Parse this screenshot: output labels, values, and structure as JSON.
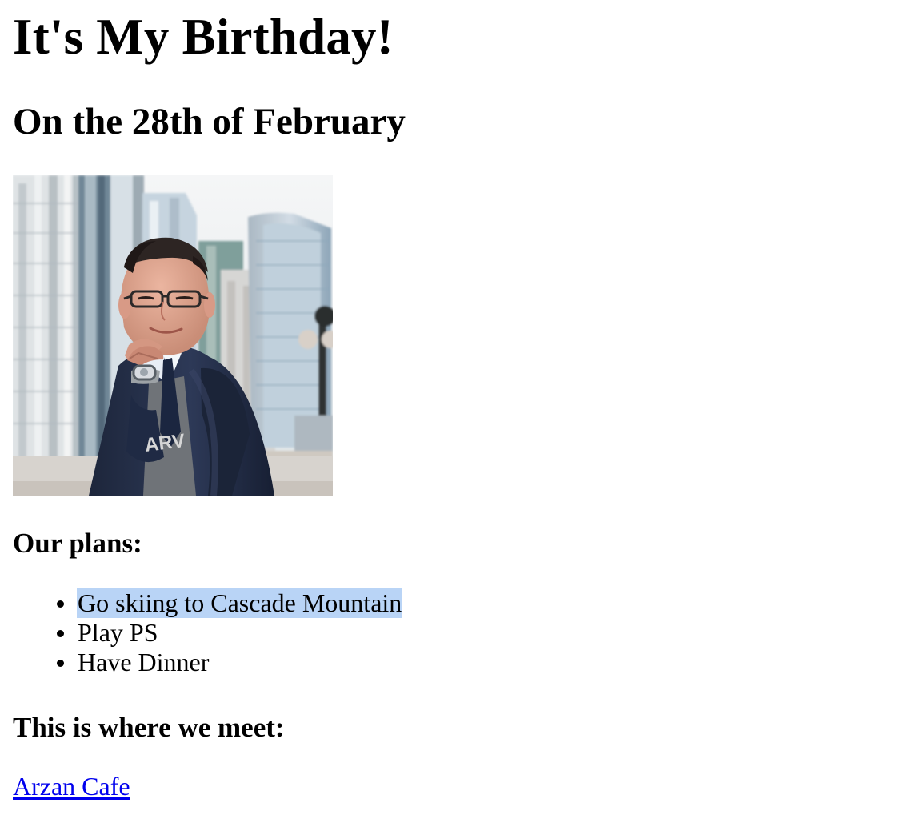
{
  "page": {
    "title": "It's My Birthday!",
    "subtitle": "On the 28th of February"
  },
  "photo": {
    "alt": "",
    "description_icon": "portrait-photo",
    "colors": {
      "sky": "#f2f2f2",
      "building_light": "#d8dfe4",
      "building_blue": "#9fb6c7",
      "building_glass": "#c9d6df",
      "jacket": "#24304a",
      "skin": "#dba18a",
      "hair": "#2d2523",
      "shirt": "#e8eef6",
      "sweater": "#6f7378"
    }
  },
  "plans": {
    "title": "Our plans:",
    "items": [
      {
        "label": "Go skiing to Cascade Mountain",
        "selected": true
      },
      {
        "label": "Play PS",
        "selected": false
      },
      {
        "label": "Have Dinner",
        "selected": false
      }
    ]
  },
  "meeting": {
    "title": "This is where we meet:",
    "link_text": "Arzan Cafe"
  },
  "colors": {
    "link": "#0000ee",
    "selection": "#b9d4f6",
    "text": "#000000",
    "background": "#ffffff"
  }
}
